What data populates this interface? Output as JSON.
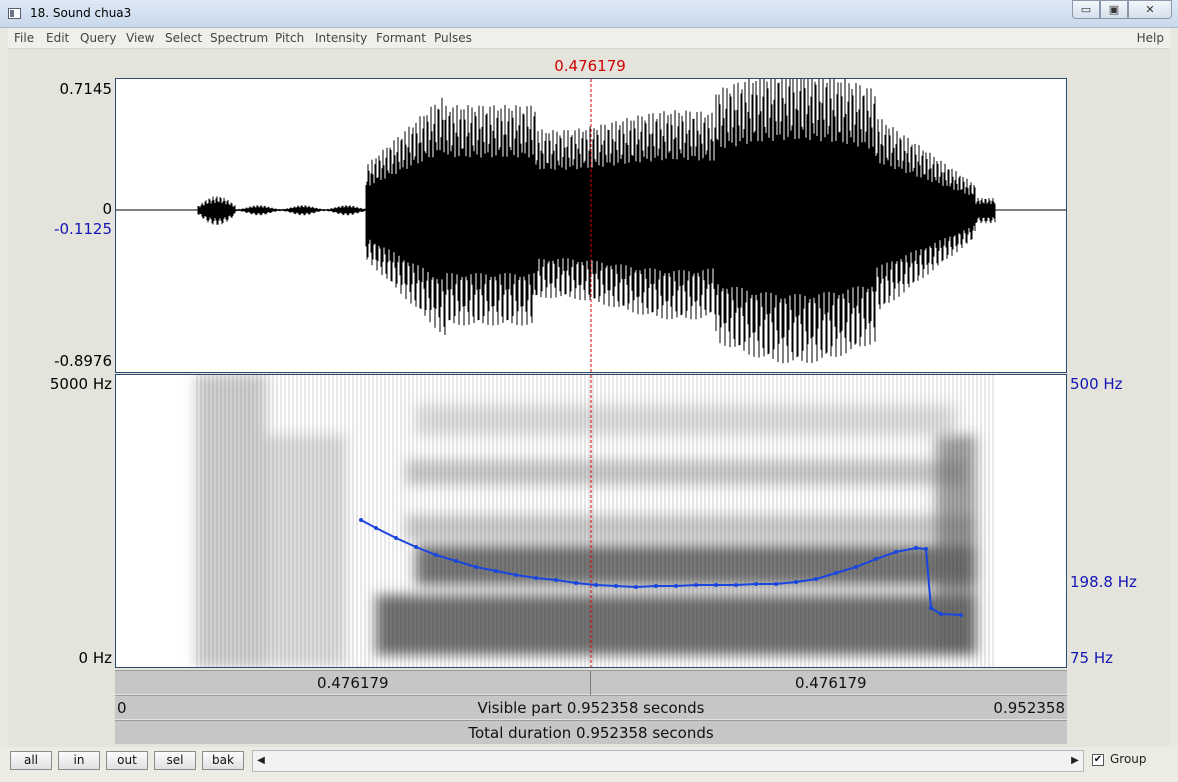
{
  "window": {
    "title": "18. Sound chua3",
    "buttons": {
      "minimize": "▭",
      "restore": "▣",
      "close": "✕"
    }
  },
  "menubar": {
    "items": [
      "File",
      "Edit",
      "Query",
      "View",
      "Select",
      "Spectrum",
      "Pitch",
      "Intensity",
      "Formant",
      "Pulses"
    ],
    "help": "Help"
  },
  "editor": {
    "cursor_time": "0.476179",
    "waveform": {
      "ymax": "0.7145",
      "zero": "0",
      "cursor_value": "-0.1125",
      "ymin": "-0.8976"
    },
    "spectrogram": {
      "fmax": "5000 Hz",
      "fmin": "0 Hz",
      "pitch_max": "500 Hz",
      "pitch_mid": "198.8 Hz",
      "pitch_min": "75 Hz"
    },
    "time_bars": {
      "left_segment": "0.476179",
      "right_segment": "0.476179",
      "visible_start": "0",
      "visible_text": "Visible part 0.952358 seconds",
      "visible_end": "0.952358",
      "total_text": "Total duration 0.952358 seconds"
    }
  },
  "bottom": {
    "buttons": [
      "all",
      "in",
      "out",
      "sel",
      "bak"
    ],
    "scroll_left": "◀",
    "scroll_right": "▶",
    "group_checked": "✔",
    "group_label": "Group"
  },
  "colors": {
    "cursor": "#d00000",
    "pitch": "#1a46e0",
    "axis_blue": "#1316b5"
  }
}
